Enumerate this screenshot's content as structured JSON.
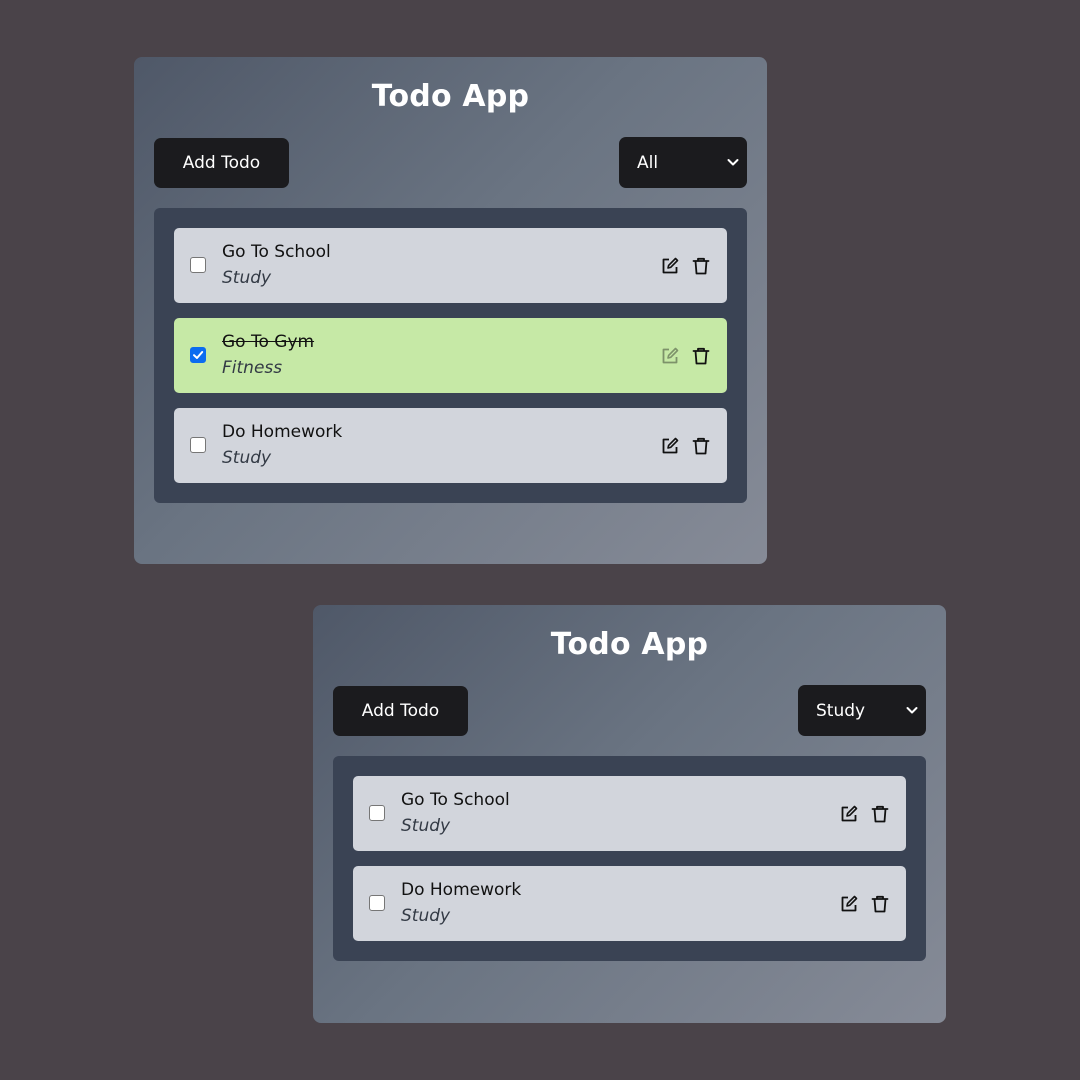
{
  "cards": [
    {
      "title": "Todo App",
      "add_button_label": "Add Todo",
      "filter_value": "All",
      "todos": [
        {
          "title": "Go To School",
          "category": "Study",
          "completed": false
        },
        {
          "title": "Go To Gym",
          "category": "Fitness",
          "completed": true
        },
        {
          "title": "Do Homework",
          "category": "Study",
          "completed": false
        }
      ]
    },
    {
      "title": "Todo App",
      "add_button_label": "Add Todo",
      "filter_value": "Study",
      "todos": [
        {
          "title": "Go To School",
          "category": "Study",
          "completed": false
        },
        {
          "title": "Do Homework",
          "category": "Study",
          "completed": false
        }
      ]
    }
  ],
  "icons": {
    "edit": "edit-icon",
    "delete": "trash-icon",
    "dropdown": "chevron-down-icon",
    "check": "checkmark-icon"
  },
  "colors": {
    "background": "#4a4349",
    "button": "#1b1b1e",
    "panel": "#3a4354",
    "item": "#d2d5dc",
    "item_completed": "#c6e9a6",
    "checkbox_checked": "#0b6cf0"
  }
}
